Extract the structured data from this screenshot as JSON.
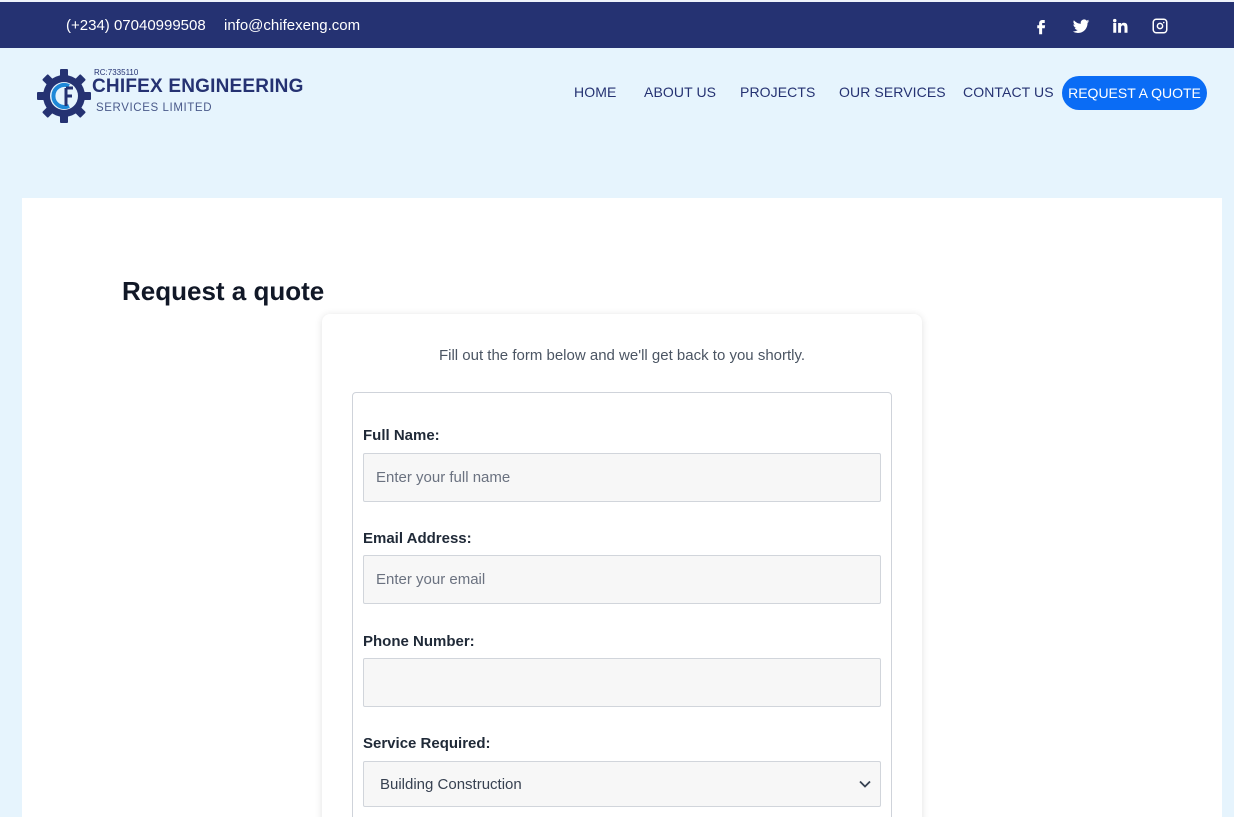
{
  "topbar": {
    "phone": "(+234) 07040999508",
    "email": "info@chifexeng.com",
    "social": [
      "facebook-icon",
      "twitter-icon",
      "linkedin-icon",
      "instagram-icon"
    ]
  },
  "brand": {
    "rc": "RC:7335110",
    "name": "CHIFEX ENGINEERING",
    "subtitle": "SERVICES LIMITED"
  },
  "nav": {
    "home": "HOME",
    "about": "ABOUT US",
    "projects": "PROJECTS",
    "services": "OUR SERVICES",
    "contact": "CONTACT US",
    "quote": "REQUEST A QUOTE"
  },
  "page": {
    "title": "Request a quote",
    "intro": "Fill out the form below and we'll get back to you shortly."
  },
  "form": {
    "full_name_label": "Full Name:",
    "full_name_placeholder": "Enter your full name",
    "email_label": "Email Address:",
    "email_placeholder": "Enter your email",
    "phone_label": "Phone Number:",
    "phone_placeholder": "",
    "service_label": "Service Required:",
    "service_selected": "Building Construction"
  },
  "colors": {
    "brand_navy": "#253272",
    "accent_blue": "#0a6cf5",
    "page_bg": "#e6f4fd"
  }
}
